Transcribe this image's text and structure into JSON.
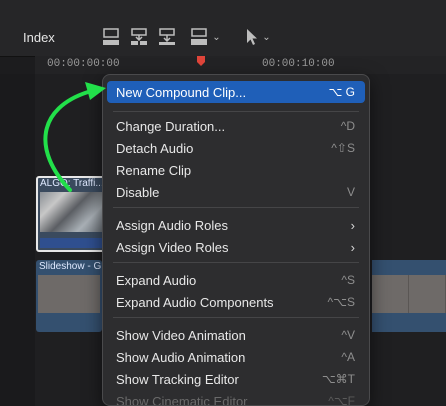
{
  "header": {
    "index_label": "Index"
  },
  "ruler": {
    "timecodes": [
      "00:00:00:00",
      "00:00:10:00"
    ]
  },
  "clips": {
    "algo": {
      "label": "ALGO: Traffi..."
    },
    "slideshow": {
      "label": "Slideshow - G"
    }
  },
  "menu": {
    "items": [
      {
        "label": "New Compound Clip...",
        "shortcut": "⌥ G",
        "highlighted": true
      },
      {
        "label": "Change Duration...",
        "shortcut": "^D"
      },
      {
        "label": "Detach Audio",
        "shortcut": "^⇧S"
      },
      {
        "label": "Rename Clip",
        "shortcut": ""
      },
      {
        "label": "Disable",
        "shortcut": "V"
      },
      {
        "label": "Assign Audio Roles",
        "submenu": true
      },
      {
        "label": "Assign Video Roles",
        "submenu": true
      },
      {
        "label": "Expand Audio",
        "shortcut": "^S"
      },
      {
        "label": "Expand Audio Components",
        "shortcut": "^⌥S"
      },
      {
        "label": "Show Video Animation",
        "shortcut": "^V"
      },
      {
        "label": "Show Audio Animation",
        "shortcut": "^A"
      },
      {
        "label": "Show Tracking Editor",
        "shortcut": "⌥⌘T"
      },
      {
        "label": "Show Cinematic Editor",
        "shortcut": "^⌥F",
        "disabled": true
      }
    ]
  },
  "colors": {
    "menu_highlight": "#1f5fb8",
    "annotation_arrow": "#22e04a",
    "playhead": "#e0453a"
  },
  "icons": [
    "append-clip-icon",
    "insert-clip-icon",
    "connect-clip-icon",
    "overwrite-clip-icon",
    "select-tool-arrow-icon",
    "chevron-down-icon"
  ]
}
